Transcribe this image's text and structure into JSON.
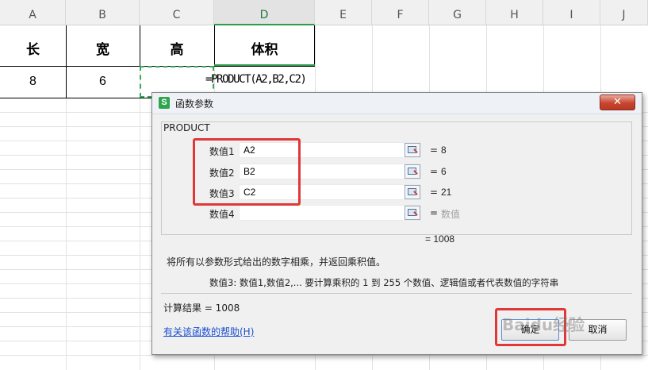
{
  "columns": [
    "A",
    "B",
    "C",
    "D",
    "E",
    "F",
    "G",
    "H",
    "I",
    "J"
  ],
  "header_row": [
    "长",
    "宽",
    "高",
    "体积"
  ],
  "data_row": [
    "8",
    "6"
  ],
  "formula": "=PRODUCT(A2,B2,C2)",
  "dialog": {
    "title": "函数参数",
    "title_icon": "S",
    "close_glyph": "✕",
    "function_name": "PRODUCT",
    "args": [
      {
        "label": "数值1",
        "value": "A2",
        "result": "8"
      },
      {
        "label": "数值2",
        "value": "B2",
        "result": "6"
      },
      {
        "label": "数值3",
        "value": "C2",
        "result": "21"
      },
      {
        "label": "数值4",
        "value": "",
        "result": "数值"
      }
    ],
    "equals": "=",
    "total_result": "= 1008",
    "description": "将所有以参数形式给出的数字相乘，并返回乘积值。",
    "param_desc": "数值3:   数值1,数值2,... 要计算乘积的 1 到 255 个数值、逻辑值或者代表数值的字符串",
    "calc_result": "计算结果 =  1008",
    "help_link": "有关该函数的帮助(H)",
    "ok_label": "确定",
    "cancel_label": "取消"
  },
  "watermark": "Baidu经验",
  "colors": {
    "accent_green": "#2a9d4b",
    "annotation_red": "#e03838",
    "link_blue": "#1a4fd0"
  }
}
